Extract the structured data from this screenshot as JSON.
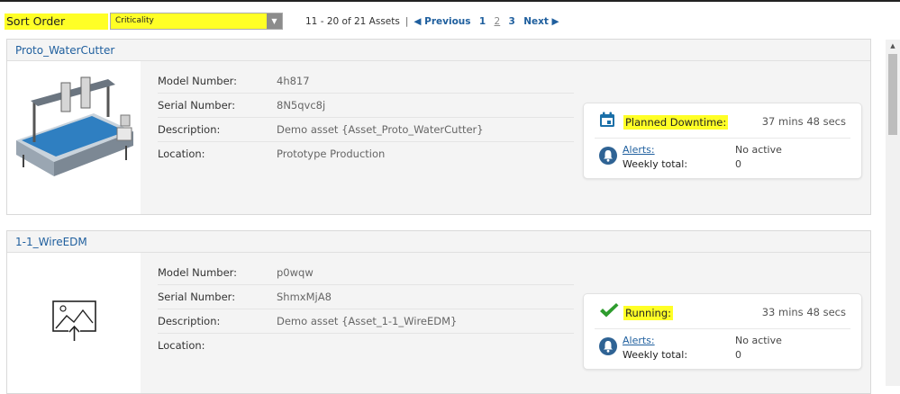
{
  "toolbar": {
    "sort_label": "Sort Order",
    "sort_value": "Criticality",
    "range_text": "11 - 20 of 21 Assets",
    "separator": "|",
    "prev_label": "◀ Previous",
    "pages": [
      "1",
      "2",
      "3"
    ],
    "current_page": "2",
    "next_label": "Next ▶"
  },
  "assets": [
    {
      "name": "Proto_WaterCutter",
      "image": "waterjet-machine-photo",
      "fields": [
        {
          "label": "Model Number:",
          "value": "4h817"
        },
        {
          "label": "Serial Number:",
          "value": "8N5qvc8j"
        },
        {
          "label": "Description:",
          "value": "Demo asset {Asset_Proto_WaterCutter}"
        },
        {
          "label": "Location:",
          "value": "Prototype Production"
        }
      ],
      "status": {
        "label": "Planned Downtime:",
        "duration": "37 mins 48 secs",
        "icon": "calendar-icon",
        "color": "#1a6fa8"
      },
      "alerts": {
        "label": "Alerts:",
        "value": "No active",
        "weekly_label": "Weekly total:",
        "weekly_value": "0"
      }
    },
    {
      "name": "1-1_WireEDM",
      "image": "image-upload-placeholder",
      "fields": [
        {
          "label": "Model Number:",
          "value": "p0wqw"
        },
        {
          "label": "Serial Number:",
          "value": "ShmxMjA8"
        },
        {
          "label": "Description:",
          "value": "Demo asset {Asset_1-1_WireEDM}"
        },
        {
          "label": "Location:",
          "value": ""
        }
      ],
      "status": {
        "label": "Running:",
        "duration": "33 mins 48 secs",
        "icon": "checkmark-icon",
        "color": "#2e9c2e"
      },
      "alerts": {
        "label": "Alerts:",
        "value": "No active",
        "weekly_label": "Weekly total:",
        "weekly_value": "0"
      }
    }
  ],
  "colors": {
    "highlight": "#ffff26",
    "link": "#1f5f9e",
    "alert_icon": "#2f6394"
  }
}
